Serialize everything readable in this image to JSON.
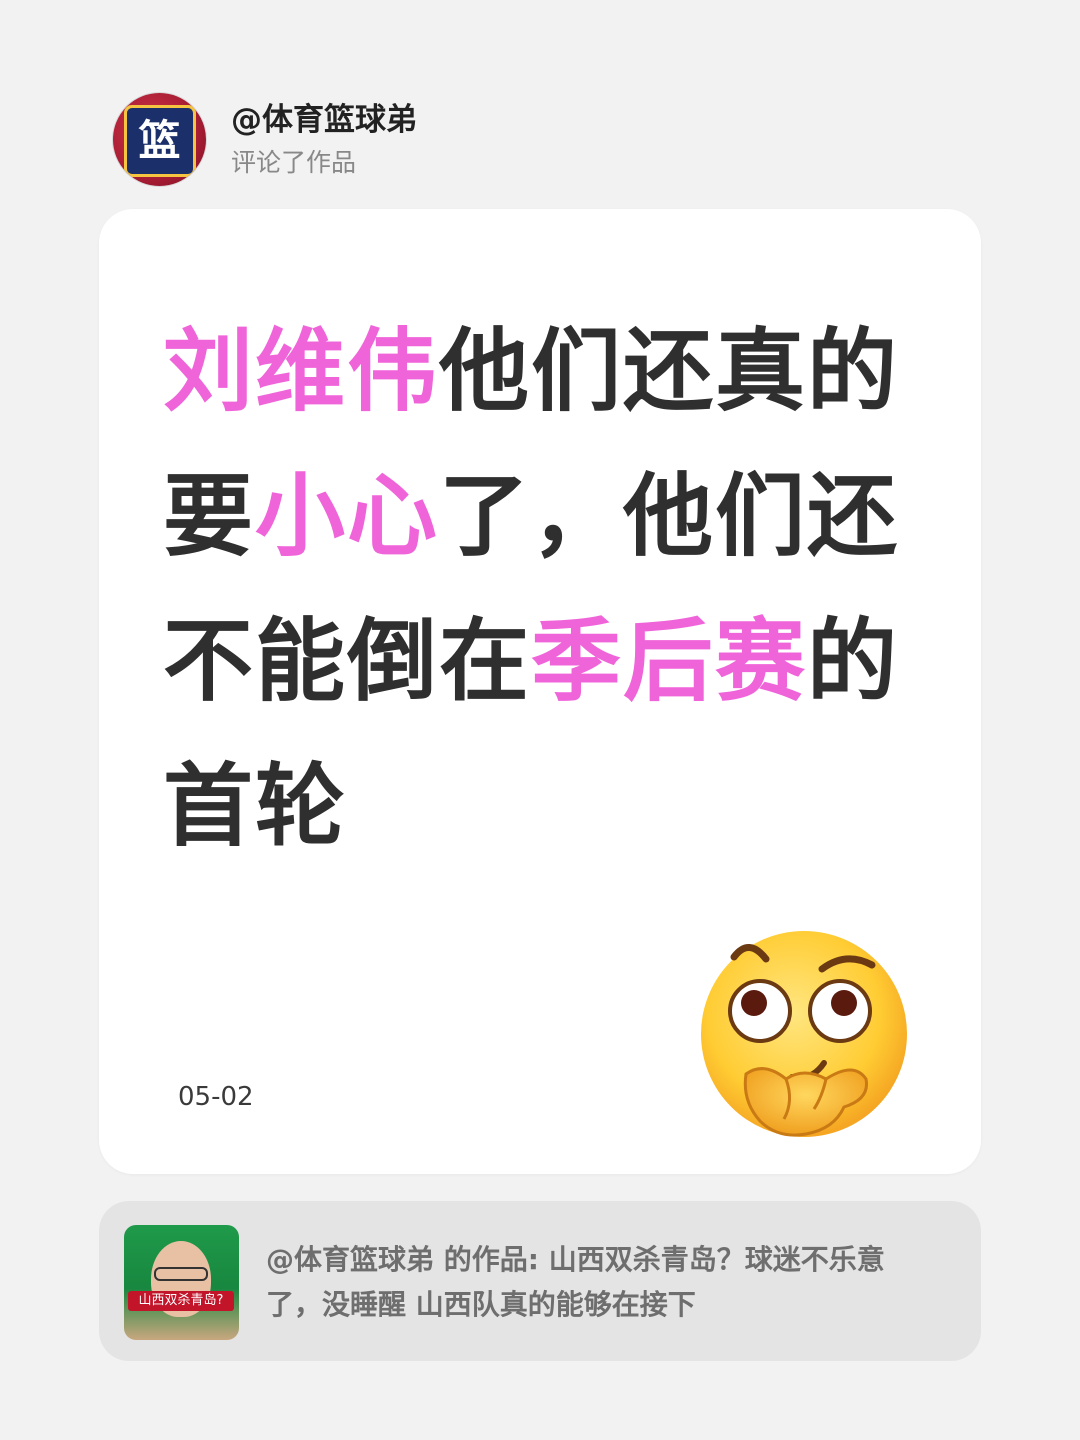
{
  "header": {
    "username": "@体育篮球弟",
    "action": "评论了作品",
    "avatar_glyph": "篮"
  },
  "comment": {
    "segments": [
      {
        "text": "刘维伟",
        "highlight": true
      },
      {
        "text": "他们还真的要",
        "highlight": false
      },
      {
        "text": "小心",
        "highlight": true
      },
      {
        "text": "了，他们还不能倒在",
        "highlight": false
      },
      {
        "text": "季后赛",
        "highlight": true
      },
      {
        "text": "的首轮",
        "highlight": false
      }
    ],
    "date": "05-02",
    "emoji": "thinking-face-emoji"
  },
  "reference": {
    "text": "@体育篮球弟 的作品: 山西双杀青岛？球迷不乐意了，没睡醒 山西队真的能够在接下",
    "thumbnail_caption": "山西双杀青岛?"
  },
  "colors": {
    "background": "#f2f2f2",
    "highlight": "#f064d9",
    "body_text": "#2f2f2f",
    "ref_background": "#e4e4e4"
  }
}
